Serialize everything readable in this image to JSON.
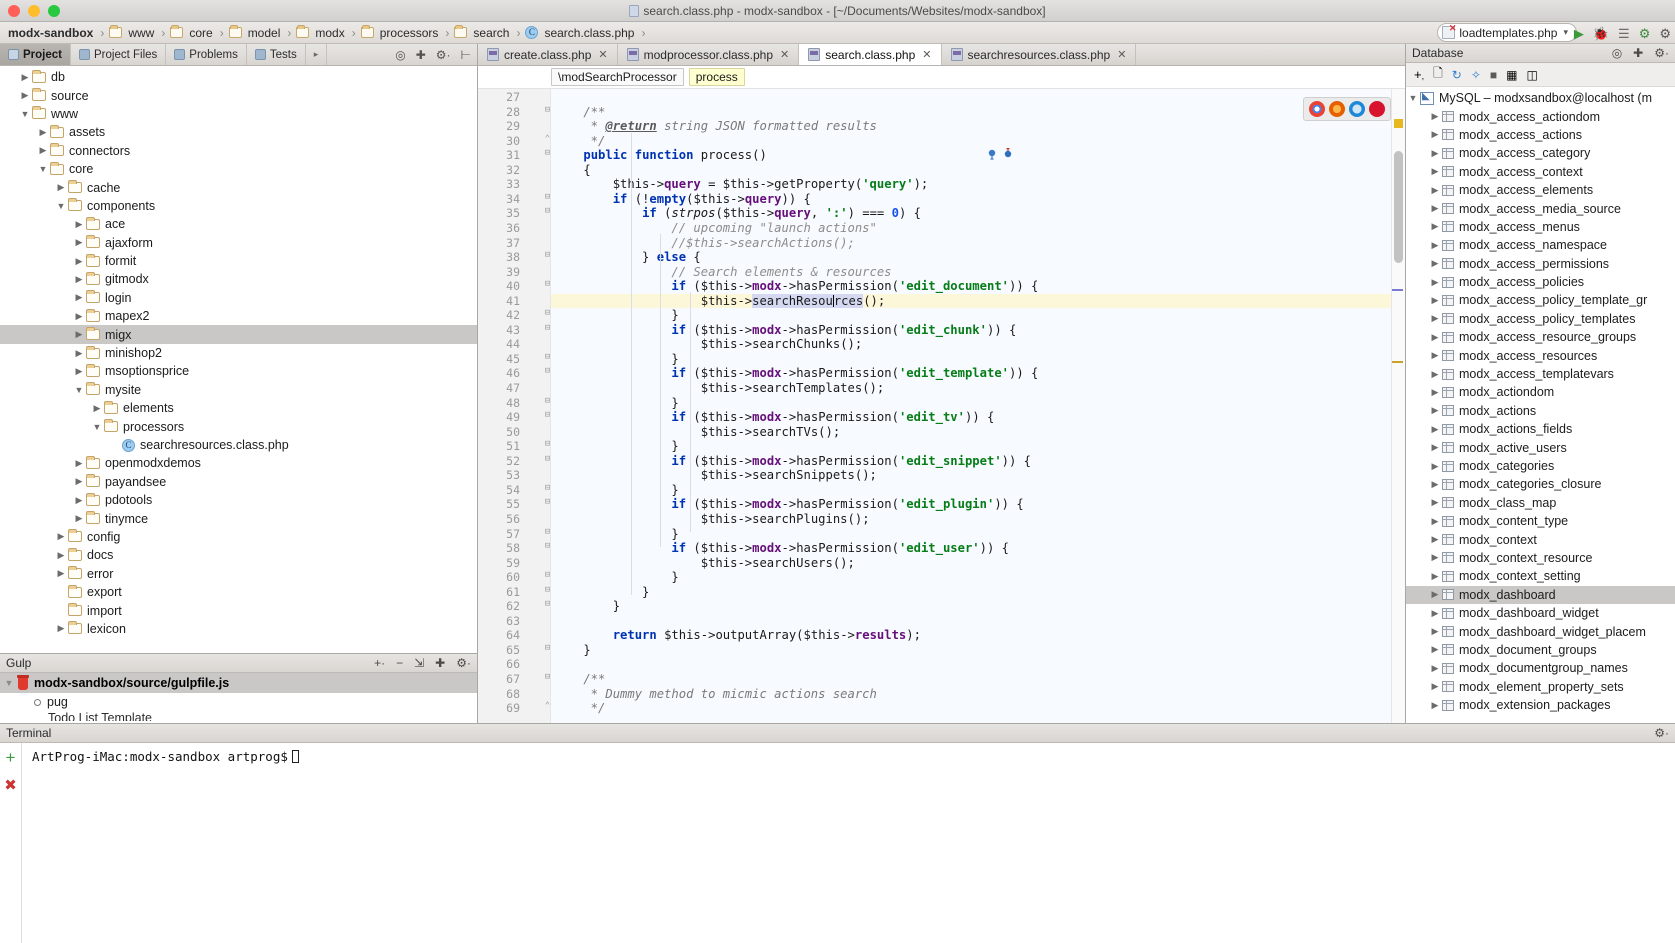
{
  "window": {
    "title": "search.class.php - modx-sandbox - [~/Documents/Websites/modx-sandbox]",
    "traffic": [
      "close",
      "minimize",
      "zoom"
    ]
  },
  "breadcrumb": {
    "items": [
      {
        "label": "modx-sandbox",
        "icon": "none"
      },
      {
        "label": "www",
        "icon": "folder-icon"
      },
      {
        "label": "core",
        "icon": "folder-icon"
      },
      {
        "label": "model",
        "icon": "folder-icon"
      },
      {
        "label": "modx",
        "icon": "folder-icon"
      },
      {
        "label": "processors",
        "icon": "folder-icon"
      },
      {
        "label": "search",
        "icon": "folder-icon"
      },
      {
        "label": "search.class.php",
        "icon": "php-class-icon"
      }
    ],
    "separator": "›"
  },
  "run_config": {
    "label": "loadtemplates.php",
    "caret": "▾",
    "buttons": [
      "run-icon",
      "debug-icon",
      "coverage-icon",
      "profile-icon",
      "settings-icon"
    ]
  },
  "project_panel": {
    "tabs": [
      {
        "label": "Project",
        "active": true
      },
      {
        "label": "Project Files",
        "active": false
      },
      {
        "label": "Problems",
        "active": false
      },
      {
        "label": "Tests",
        "active": false
      }
    ],
    "overflow_arrow": "▸",
    "tools": [
      "locate-icon",
      "collapse-all-icon",
      "settings-icon",
      "hide-icon"
    ],
    "tree": [
      {
        "label": "db",
        "depth": 1,
        "twisty": "right",
        "kind": "folder",
        "selected": false
      },
      {
        "label": "source",
        "depth": 1,
        "twisty": "right",
        "kind": "folder",
        "selected": false
      },
      {
        "label": "www",
        "depth": 1,
        "twisty": "down",
        "kind": "folder",
        "selected": false
      },
      {
        "label": "assets",
        "depth": 2,
        "twisty": "right",
        "kind": "folder",
        "selected": false
      },
      {
        "label": "connectors",
        "depth": 2,
        "twisty": "right",
        "kind": "folder",
        "selected": false
      },
      {
        "label": "core",
        "depth": 2,
        "twisty": "down",
        "kind": "folder",
        "selected": false
      },
      {
        "label": "cache",
        "depth": 3,
        "twisty": "right",
        "kind": "folder",
        "selected": false
      },
      {
        "label": "components",
        "depth": 3,
        "twisty": "down",
        "kind": "folder",
        "selected": false
      },
      {
        "label": "ace",
        "depth": 4,
        "twisty": "right",
        "kind": "folder",
        "selected": false
      },
      {
        "label": "ajaxform",
        "depth": 4,
        "twisty": "right",
        "kind": "folder",
        "selected": false
      },
      {
        "label": "formit",
        "depth": 4,
        "twisty": "right",
        "kind": "folder",
        "selected": false
      },
      {
        "label": "gitmodx",
        "depth": 4,
        "twisty": "right",
        "kind": "folder",
        "selected": false
      },
      {
        "label": "login",
        "depth": 4,
        "twisty": "right",
        "kind": "folder",
        "selected": false
      },
      {
        "label": "mapex2",
        "depth": 4,
        "twisty": "right",
        "kind": "folder",
        "selected": false
      },
      {
        "label": "migx",
        "depth": 4,
        "twisty": "right",
        "kind": "folder",
        "selected": true
      },
      {
        "label": "minishop2",
        "depth": 4,
        "twisty": "right",
        "kind": "folder",
        "selected": false
      },
      {
        "label": "msoptionsprice",
        "depth": 4,
        "twisty": "right",
        "kind": "folder",
        "selected": false
      },
      {
        "label": "mysite",
        "depth": 4,
        "twisty": "down",
        "kind": "folder",
        "selected": false
      },
      {
        "label": "elements",
        "depth": 5,
        "twisty": "right",
        "kind": "folder",
        "selected": false
      },
      {
        "label": "processors",
        "depth": 5,
        "twisty": "down",
        "kind": "folder",
        "selected": false
      },
      {
        "label": "searchresources.class.php",
        "depth": 6,
        "twisty": "none",
        "kind": "php",
        "selected": false
      },
      {
        "label": "openmodxdemos",
        "depth": 4,
        "twisty": "right",
        "kind": "folder",
        "selected": false
      },
      {
        "label": "payandsee",
        "depth": 4,
        "twisty": "right",
        "kind": "folder",
        "selected": false
      },
      {
        "label": "pdotools",
        "depth": 4,
        "twisty": "right",
        "kind": "folder",
        "selected": false
      },
      {
        "label": "tinymce",
        "depth": 4,
        "twisty": "right",
        "kind": "folder",
        "selected": false
      },
      {
        "label": "config",
        "depth": 3,
        "twisty": "right",
        "kind": "folder",
        "selected": false
      },
      {
        "label": "docs",
        "depth": 3,
        "twisty": "right",
        "kind": "folder",
        "selected": false
      },
      {
        "label": "error",
        "depth": 3,
        "twisty": "right",
        "kind": "folder",
        "selected": false
      },
      {
        "label": "export",
        "depth": 3,
        "twisty": "none",
        "kind": "folder",
        "selected": false
      },
      {
        "label": "import",
        "depth": 3,
        "twisty": "none",
        "kind": "folder",
        "selected": false
      },
      {
        "label": "lexicon",
        "depth": 3,
        "twisty": "right",
        "kind": "folder",
        "selected": false
      }
    ]
  },
  "gulp_panel": {
    "title": "Gulp",
    "tools": [
      "add-icon",
      "remove-icon",
      "expand-icon",
      "collapse-icon",
      "settings-icon"
    ],
    "root": "modx-sandbox/source/gulpfile.js",
    "task": "pug",
    "clipped_task": "Todo List Template"
  },
  "editor": {
    "tabs": [
      {
        "label": "create.class.php",
        "active": false,
        "close": "✕"
      },
      {
        "label": "modprocessor.class.php",
        "active": false,
        "close": "✕"
      },
      {
        "label": "search.class.php",
        "active": true,
        "close": "✕"
      },
      {
        "label": "searchresources.class.php",
        "active": false,
        "close": "✕"
      }
    ],
    "breadcrumb_chips": [
      {
        "label": "\\modSearchProcessor",
        "highlight": false
      },
      {
        "label": "process",
        "highlight": true
      }
    ],
    "browsers": [
      "chrome-icon",
      "firefox-icon",
      "safari-icon",
      "opera-icon"
    ],
    "caret_line": 41,
    "first_line": 27,
    "lines": [
      {
        "n": 27,
        "fold": "",
        "text": ""
      },
      {
        "n": 28,
        "fold": "-",
        "text": "    /**"
      },
      {
        "n": 29,
        "fold": "",
        "text": "     * @return string JSON formatted results"
      },
      {
        "n": 30,
        "fold": "^",
        "text": "     */"
      },
      {
        "n": 31,
        "fold": "-",
        "text": "    public function process()"
      },
      {
        "n": 32,
        "fold": "",
        "text": "    {"
      },
      {
        "n": 33,
        "fold": "",
        "text": "        $this->query = $this->getProperty('query');"
      },
      {
        "n": 34,
        "fold": "-",
        "text": "        if (!empty($this->query)) {"
      },
      {
        "n": 35,
        "fold": "-",
        "text": "            if (strpos($this->query, ':') === 0) {"
      },
      {
        "n": 36,
        "fold": "",
        "text": "                // upcoming \"launch actions\""
      },
      {
        "n": 37,
        "fold": "",
        "text": "                //$this->searchActions();"
      },
      {
        "n": 38,
        "fold": "-",
        "text": "            } else {"
      },
      {
        "n": 39,
        "fold": "",
        "text": "                // Search elements & resources"
      },
      {
        "n": 40,
        "fold": "-",
        "text": "                if ($this->modx->hasPermission('edit_document')) {"
      },
      {
        "n": 41,
        "fold": "",
        "text": "                    $this->searchResources();"
      },
      {
        "n": 42,
        "fold": "-",
        "text": "                }"
      },
      {
        "n": 43,
        "fold": "-",
        "text": "                if ($this->modx->hasPermission('edit_chunk')) {"
      },
      {
        "n": 44,
        "fold": "",
        "text": "                    $this->searchChunks();"
      },
      {
        "n": 45,
        "fold": "-",
        "text": "                }"
      },
      {
        "n": 46,
        "fold": "-",
        "text": "                if ($this->modx->hasPermission('edit_template')) {"
      },
      {
        "n": 47,
        "fold": "",
        "text": "                    $this->searchTemplates();"
      },
      {
        "n": 48,
        "fold": "-",
        "text": "                }"
      },
      {
        "n": 49,
        "fold": "-",
        "text": "                if ($this->modx->hasPermission('edit_tv')) {"
      },
      {
        "n": 50,
        "fold": "",
        "text": "                    $this->searchTVs();"
      },
      {
        "n": 51,
        "fold": "-",
        "text": "                }"
      },
      {
        "n": 52,
        "fold": "-",
        "text": "                if ($this->modx->hasPermission('edit_snippet')) {"
      },
      {
        "n": 53,
        "fold": "",
        "text": "                    $this->searchSnippets();"
      },
      {
        "n": 54,
        "fold": "-",
        "text": "                }"
      },
      {
        "n": 55,
        "fold": "-",
        "text": "                if ($this->modx->hasPermission('edit_plugin')) {"
      },
      {
        "n": 56,
        "fold": "",
        "text": "                    $this->searchPlugins();"
      },
      {
        "n": 57,
        "fold": "-",
        "text": "                }"
      },
      {
        "n": 58,
        "fold": "-",
        "text": "                if ($this->modx->hasPermission('edit_user')) {"
      },
      {
        "n": 59,
        "fold": "",
        "text": "                    $this->searchUsers();"
      },
      {
        "n": 60,
        "fold": "-",
        "text": "                }"
      },
      {
        "n": 61,
        "fold": "-",
        "text": "            }"
      },
      {
        "n": 62,
        "fold": "-",
        "text": "        }"
      },
      {
        "n": 63,
        "fold": "",
        "text": ""
      },
      {
        "n": 64,
        "fold": "",
        "text": "        return $this->outputArray($this->results);"
      },
      {
        "n": 65,
        "fold": "-",
        "text": "    }"
      },
      {
        "n": 66,
        "fold": "",
        "text": ""
      },
      {
        "n": 67,
        "fold": "-",
        "text": "    /**"
      },
      {
        "n": 68,
        "fold": "",
        "text": "     * Dummy method to micmic actions search"
      },
      {
        "n": 69,
        "fold": "^",
        "text": "     */"
      }
    ]
  },
  "database_panel": {
    "title": "Database",
    "header_tools": [
      "locate-icon",
      "collapse-all-icon",
      "settings-icon",
      "hide-icon"
    ],
    "toolbar": [
      "add-icon",
      "copy-icon",
      "refresh-icon",
      "sync-icon",
      "stop-icon",
      "table-icon",
      "console-icon"
    ],
    "connection": "MySQL – modxsandbox@localhost (m",
    "tables": [
      "modx_access_actiondom",
      "modx_access_actions",
      "modx_access_category",
      "modx_access_context",
      "modx_access_elements",
      "modx_access_media_source",
      "modx_access_menus",
      "modx_access_namespace",
      "modx_access_permissions",
      "modx_access_policies",
      "modx_access_policy_template_gr",
      "modx_access_policy_templates",
      "modx_access_resource_groups",
      "modx_access_resources",
      "modx_access_templatevars",
      "modx_actiondom",
      "modx_actions",
      "modx_actions_fields",
      "modx_active_users",
      "modx_categories",
      "modx_categories_closure",
      "modx_class_map",
      "modx_content_type",
      "modx_context",
      "modx_context_resource",
      "modx_context_setting",
      "modx_dashboard",
      "modx_dashboard_widget",
      "modx_dashboard_widget_placem",
      "modx_document_groups",
      "modx_documentgroup_names",
      "modx_element_property_sets",
      "modx_extension_packages"
    ],
    "selected_table": "modx_dashboard"
  },
  "terminal": {
    "title": "Terminal",
    "prompt": "ArtProg-iMac:modx-sandbox artprog$",
    "side_buttons": [
      "add-tab-icon",
      "close-tab-icon"
    ]
  },
  "colors": {
    "keyword": "#0033b3",
    "string": "#067d17",
    "comment": "#8c8c8c",
    "field": "#660e7a",
    "number": "#1750eb",
    "selection": "#d4d8f0",
    "caret_line": "#fdf7d9",
    "row_selected": "#c9c8c6"
  }
}
